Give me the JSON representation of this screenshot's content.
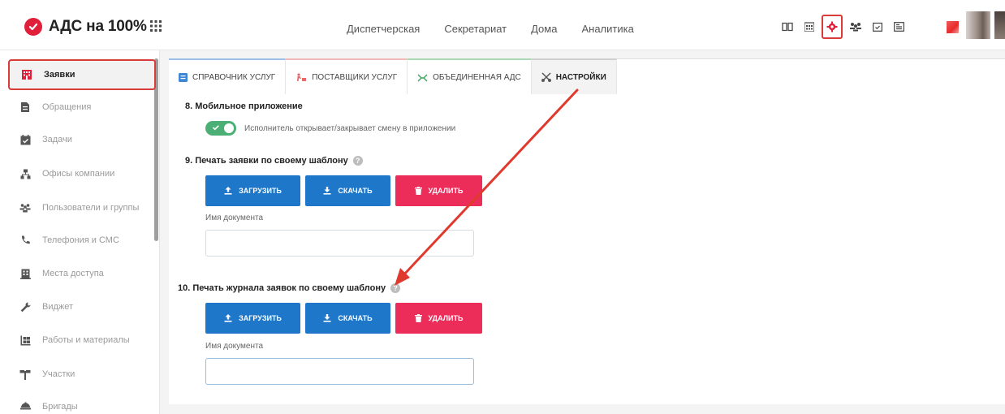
{
  "header": {
    "logo_text": "АДС на 100%",
    "nav": [
      "Диспетчерская",
      "Секретариат",
      "Дома",
      "Аналитика"
    ],
    "icons": [
      "book-icon",
      "calendar-icon",
      "gear-icon",
      "users-icon",
      "calendar-check-icon",
      "newspaper-icon"
    ],
    "active_icon": "gear-icon"
  },
  "sidebar": {
    "items": [
      {
        "label": "Заявки",
        "icon": "building-icon",
        "active": true
      },
      {
        "label": "Обращения",
        "icon": "document-icon",
        "active": false
      },
      {
        "label": "Задачи",
        "icon": "calendar-icon",
        "active": false
      },
      {
        "label": "Офисы компании",
        "icon": "network-icon",
        "active": false
      },
      {
        "label": "Пользователи и группы",
        "icon": "users-icon",
        "active": false
      },
      {
        "label": "Телефония и СМС",
        "icon": "phone-icon",
        "active": false
      },
      {
        "label": "Места доступа",
        "icon": "building-icon",
        "active": false
      },
      {
        "label": "Виджет",
        "icon": "wrench-icon",
        "active": false
      },
      {
        "label": "Работы и материалы",
        "icon": "materials-icon",
        "active": false
      },
      {
        "label": "Участки",
        "icon": "sign-icon",
        "active": false
      },
      {
        "label": "Бригады",
        "icon": "team-icon",
        "active": false
      }
    ]
  },
  "tabs": [
    {
      "label": "Справочник услуг",
      "icon": "list-icon"
    },
    {
      "label": "Поставщики услуг",
      "icon": "delivery-icon"
    },
    {
      "label": "Объединенная АДС",
      "icon": "merge-icon"
    },
    {
      "label": "Настройки",
      "icon": "tools-icon",
      "active": true
    }
  ],
  "sections": {
    "mobile": {
      "title": "8. Мобильное приложение",
      "toggle_label": "Исполнитель открывает/закрывает смену в приложении",
      "toggle_on": true
    },
    "print_request": {
      "title": "9. Печать заявки по своему шаблону",
      "upload": "Загрузить",
      "download": "Скачать",
      "delete": "Удалить",
      "doc_label": "Имя документа",
      "doc_value": ""
    },
    "print_journal": {
      "title": "10. Печать журнала заявок по своему шаблону",
      "upload": "Загрузить",
      "download": "Скачать",
      "delete": "Удалить",
      "doc_label": "Имя документа",
      "doc_value": ""
    }
  },
  "colors": {
    "brand": "#e0203a",
    "primary": "#1f77c9",
    "danger": "#ec2d5a",
    "toggle": "#4caf75",
    "highlight": "#d93a3a"
  }
}
